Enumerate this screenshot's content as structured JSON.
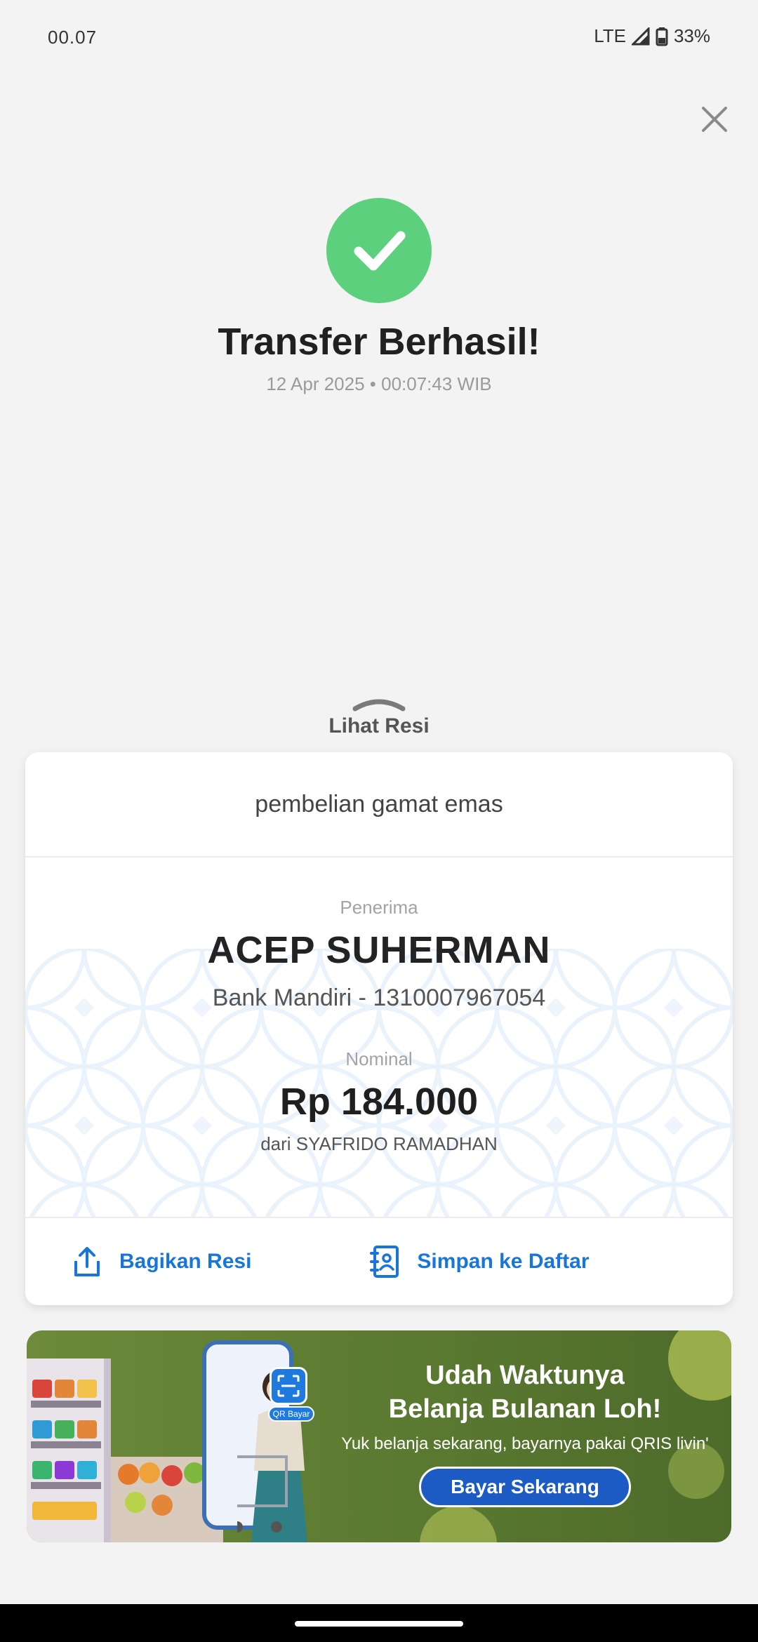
{
  "status_bar": {
    "time": "00.07",
    "network": "LTE",
    "battery": "33%"
  },
  "header": {
    "title": "Transfer Berhasil!",
    "datetime": "12 Apr 2025 • 00:07:43 WIB"
  },
  "receipt_toggle": {
    "label": "Lihat Resi"
  },
  "receipt": {
    "note": "pembelian gamat emas",
    "recipient_label": "Penerima",
    "recipient_name": "ACEP SUHERMAN",
    "recipient_bank": "Bank Mandiri - 1310007967054",
    "nominal_label": "Nominal",
    "amount": "Rp 184.000",
    "sender": "dari SYAFRIDO RAMADHAN"
  },
  "actions": {
    "share_label": "Bagikan Resi",
    "save_label": "Simpan ke Daftar"
  },
  "banner": {
    "headline_line1": "Udah Waktunya",
    "headline_line2": "Belanja Bulanan Loh!",
    "subtitle": "Yuk belanja sekarang, bayarnya pakai QRIS livin'",
    "qr_label": "QR Bayar",
    "cta_label": "Bayar Sekarang"
  },
  "icons": {
    "close": "close-icon",
    "success": "checkmark-icon",
    "share": "share-upload-icon",
    "save": "contact-book-icon",
    "chevron": "chevron-up-icon"
  },
  "colors": {
    "success_green": "#5cd07d",
    "action_blue": "#1876d9",
    "banner_green": "#5f7e33",
    "banner_button": "#1d5bc4"
  }
}
